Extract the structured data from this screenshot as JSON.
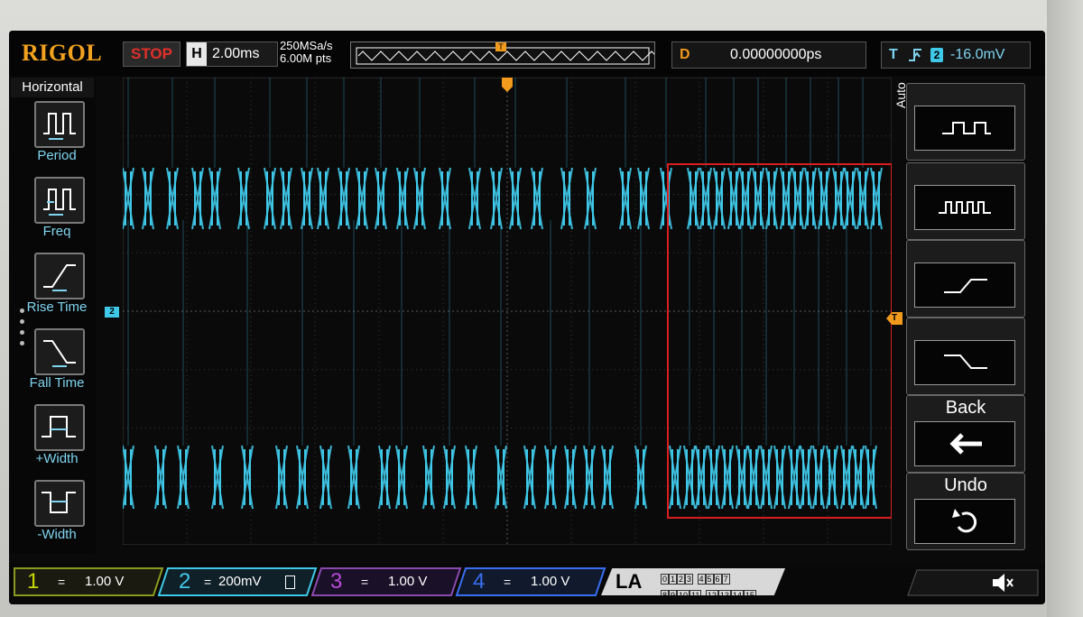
{
  "brand": "RIGOL",
  "run_state": "STOP",
  "horizontal": {
    "label": "H",
    "timebase": "2.00ms",
    "sample_rate": "250MSa/s",
    "memory_depth": "6.00M pts"
  },
  "trigger_strip_marker": "T",
  "delay": {
    "label": "D",
    "value": "0.00000000ps"
  },
  "trigger": {
    "label": "T",
    "edge": "rising-edge-icon",
    "source": "2",
    "level": "-16.0mV"
  },
  "left_menu": {
    "title": "Horizontal",
    "items": [
      {
        "label": "Period",
        "icon": "period-icon"
      },
      {
        "label": "Freq",
        "icon": "frequency-icon"
      },
      {
        "label": "Rise Time",
        "icon": "rise-time-icon"
      },
      {
        "label": "Fall Time",
        "icon": "fall-time-icon"
      },
      {
        "label": "+Width",
        "icon": "positive-width-icon"
      },
      {
        "label": "-Width",
        "icon": "negative-width-icon"
      }
    ]
  },
  "right_menu": {
    "auto_label": "Auto",
    "buttons": [
      {
        "icon": "single-pulse-waveform-icon"
      },
      {
        "icon": "multi-pulse-waveform-icon"
      },
      {
        "icon": "rising-edge-waveform-icon"
      },
      {
        "icon": "falling-edge-waveform-icon"
      },
      {
        "title": "Back",
        "icon": "back-arrow-icon"
      },
      {
        "title": "Undo",
        "icon": "undo-icon"
      }
    ]
  },
  "channel_marker": "2",
  "trigger_level_marker": "T",
  "channels": [
    {
      "num": "1",
      "coupling": "=",
      "scale": "1.00 V",
      "color": "#c8d800"
    },
    {
      "num": "2",
      "coupling": "=",
      "scale": "200mV",
      "color": "#3fc8e8"
    },
    {
      "num": "3",
      "coupling": "=",
      "scale": "1.00 V",
      "color": "#b84ad8"
    },
    {
      "num": "4",
      "coupling": "=",
      "scale": "1.00 V",
      "color": "#3a6ef0"
    }
  ],
  "logic_analyzer": {
    "label": "LA",
    "bits_row1": [
      "0",
      "1",
      "2",
      "3",
      "4",
      "5",
      "6",
      "7"
    ],
    "bits_row2": [
      "8",
      "9",
      "10",
      "11",
      "12",
      "13",
      "14",
      "15"
    ]
  },
  "speaker_icon": "speaker-muted-icon",
  "colors": {
    "accent_orange": "#f29a1c",
    "ch2": "#3fc8e8",
    "highlight_box": "#d81e1e"
  }
}
